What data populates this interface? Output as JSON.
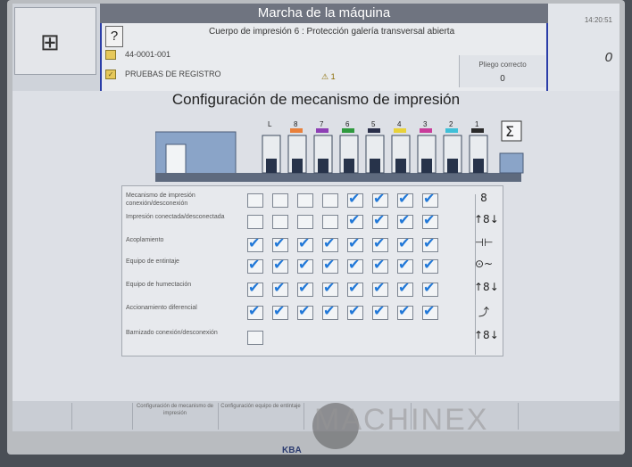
{
  "header": {
    "window_title": "Marcha de la máquina",
    "help_label": "?",
    "status_message": "Cuerpo de impresión 6 :  Protección galería transversal abierta",
    "job_number": "44-0001-001",
    "job_name": "PRUEBAS DE REGISTRO",
    "warning_text": "⚠ 1",
    "pliego_label": "Pliego correcto",
    "pliego_value": "0",
    "time": "14:20:51",
    "counter": "0"
  },
  "config": {
    "title": "Configuración de mecanismo de impresión",
    "units": [
      "L",
      "8",
      "7",
      "6",
      "5",
      "4",
      "3",
      "2",
      "1"
    ],
    "unit_colors": [
      "",
      "#e9803a",
      "#8e3fb5",
      "#2f9a3e",
      "#2a2f4a",
      "#e8d23a",
      "#c93c9a",
      "#3fc0d8",
      "#2a2a2a"
    ],
    "sum_symbol": "Σ",
    "rows": [
      {
        "label": "Mecanismo de impresión conexión/desconexión",
        "icon": "8",
        "checks": [
          false,
          false,
          false,
          false,
          true,
          true,
          true,
          true
        ],
        "boxes": 8
      },
      {
        "label": "Impresión conectada/desconectada",
        "icon": "↑8↓",
        "checks": [
          false,
          false,
          false,
          false,
          true,
          true,
          true,
          true
        ],
        "boxes": 8
      },
      {
        "label": "Acoplamiento",
        "icon": "⊣⊢",
        "checks": [
          true,
          true,
          true,
          true,
          true,
          true,
          true,
          true
        ],
        "boxes": 8
      },
      {
        "label": "Equipo de entintaje",
        "icon": "⊙~",
        "checks": [
          true,
          true,
          true,
          true,
          true,
          true,
          true,
          true
        ],
        "boxes": 8
      },
      {
        "label": "Equipo de humectación",
        "icon": "↑8↓",
        "checks": [
          true,
          true,
          true,
          true,
          true,
          true,
          true,
          true
        ],
        "boxes": 8
      },
      {
        "label": "Accionamiento diferencial",
        "icon": "⤴",
        "checks": [
          true,
          true,
          true,
          true,
          true,
          true,
          true,
          true
        ],
        "boxes": 8
      },
      {
        "label": "Barnizado conexión/desconexión",
        "icon": "↑8↓",
        "checks": [
          false
        ],
        "boxes": 1
      }
    ]
  },
  "footer": {
    "buttons": [
      "",
      "",
      "Configuración de mecanismo de impresión",
      "Configuración equipo de entintaje",
      "",
      "",
      ""
    ]
  },
  "brand": {
    "logo": "KBA",
    "watermark": "MACHINEX"
  }
}
